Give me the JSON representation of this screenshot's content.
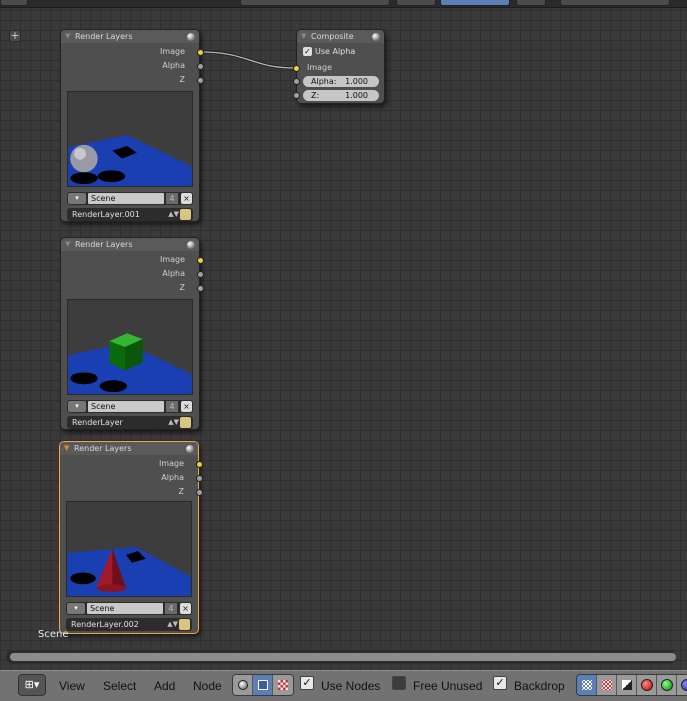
{
  "nodes": {
    "render_layers_1": {
      "title": "Render Layers",
      "outputs": [
        "Image",
        "Alpha",
        "Z"
      ],
      "scene": "Scene",
      "scene_users": "4",
      "layer": "RenderLayer.001",
      "preview_object": "sphere"
    },
    "render_layers_2": {
      "title": "Render Layers",
      "outputs": [
        "Image",
        "Alpha",
        "Z"
      ],
      "scene": "Scene",
      "scene_users": "4",
      "layer": "RenderLayer",
      "preview_object": "cube"
    },
    "render_layers_3": {
      "title": "Render Layers",
      "outputs": [
        "Image",
        "Alpha",
        "Z"
      ],
      "scene": "Scene",
      "scene_users": "4",
      "layer": "RenderLayer.002",
      "preview_object": "cone",
      "selected": true
    },
    "composite": {
      "title": "Composite",
      "use_alpha_label": "Use Alpha",
      "use_alpha_checked": true,
      "input_image": "Image",
      "alpha_label": "Alpha:",
      "alpha_value": "1.000",
      "z_label": "Z:",
      "z_value": "1.000"
    }
  },
  "canvas": {
    "scene_name": "Scene"
  },
  "footer": {
    "editor_type_icon": "node-editor-icon",
    "menu": [
      "View",
      "Select",
      "Add",
      "Node"
    ],
    "node_tree_types": [
      "shader-nodes-icon",
      "compositing-nodes-icon",
      "texture-nodes-icon"
    ],
    "use_nodes": {
      "label": "Use Nodes",
      "checked": true
    },
    "free_unused": {
      "label": "Free Unused",
      "checked": false
    },
    "backdrop": {
      "label": "Backdrop",
      "checked": true
    },
    "backdrop_channels": [
      "checker-icon",
      "checker-alpha-icon",
      "half-icon",
      "red-icon",
      "green-icon",
      "blue-icon"
    ]
  },
  "colors": {
    "socket_image": "#e0d53e",
    "socket_value": "#a0a0a0",
    "selection": "#f1a54a",
    "preview_floor": "#1a3fb3",
    "cube": "#1a8a1a",
    "cone": "#a01a2a"
  }
}
